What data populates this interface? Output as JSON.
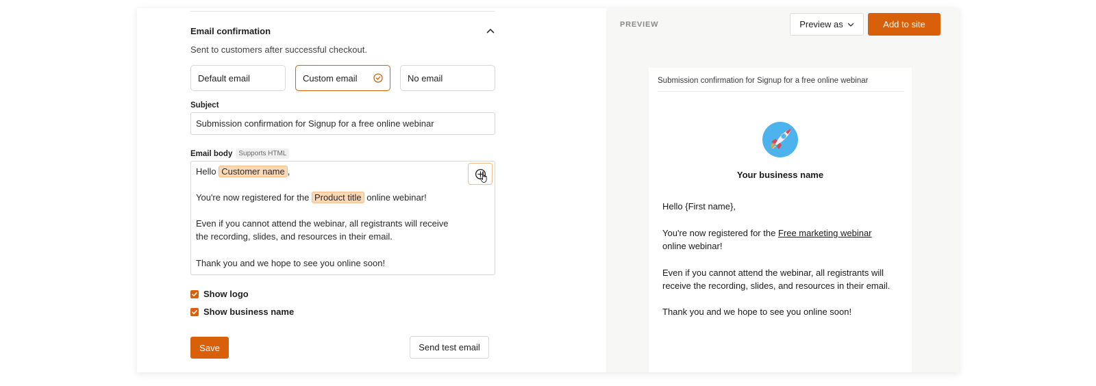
{
  "editor": {
    "section_title": "Email confirmation",
    "section_description": "Sent to customers after successful checkout.",
    "email_options": [
      {
        "label": "Default email",
        "selected": false
      },
      {
        "label": "Custom email",
        "selected": true
      },
      {
        "label": "No email",
        "selected": false
      }
    ],
    "subject_label": "Subject",
    "subject_value": "Submission confirmation for Signup for a free online webinar",
    "body_label": "Email body",
    "body_badge": "Supports HTML",
    "body": {
      "greeting": "Hello",
      "customer_tag": "Customer name",
      "greeting_end": ",",
      "line2_before": "You're now registered for the",
      "product_tag": "Product title",
      "line2_after": "online webinar!",
      "line3a": "Even if you cannot attend the webinar, all registrants will receive",
      "line3b": "the recording, slides, and resources in their email.",
      "line4": "Thank you and we hope to see you online soon!"
    },
    "show_logo_label": "Show logo",
    "show_logo_checked": true,
    "show_business_name_label": "Show business name",
    "show_business_name_checked": true,
    "save_label": "Save",
    "send_test_label": "Send test email"
  },
  "preview": {
    "header_label": "PREVIEW",
    "preview_as_label": "Preview as",
    "add_to_site_label": "Add to site",
    "subject": "Submission confirmation for Signup for a free online webinar",
    "business_name": "Your business name",
    "greeting": "Hello {First name},",
    "line2_before": "You're now registered for the",
    "line2_link": "Free marketing webinar",
    "line2_after": "online webinar!",
    "line3a": "Even if you cannot attend the webinar, all registrants will",
    "line3b": "receive the recording, slides, and resources in their email.",
    "line4": "Thank you and we hope to see you online soon!"
  },
  "colors": {
    "accent": "#d9600a",
    "tag_bg": "#fcd9b4",
    "preview_bg": "#f7f7f5"
  },
  "icons": {
    "collapse": "chevron-up-icon",
    "selected": "check-circle-icon",
    "insert": "plus-circle-icon",
    "cursor": "hand-pointer-icon",
    "dropdown": "chevron-down-icon",
    "logo": "rocket-icon"
  }
}
